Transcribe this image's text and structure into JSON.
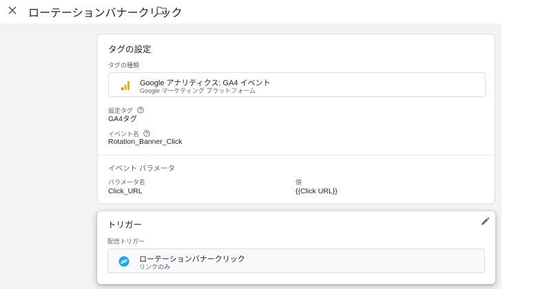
{
  "header": {
    "title": "ローテーションバナークリック",
    "close_icon": "close-icon",
    "folder_icon": "folder-icon"
  },
  "tag_config": {
    "section_title": "タグの設定",
    "tag_type_label": "タグの種類",
    "tag_type_name": "Google アナリティクス: GA4 イベント",
    "tag_type_sub": "Google マーケティング プラットフォーム",
    "config_tag_label": "設定タグ",
    "config_tag_value": "GA4タグ",
    "event_name_label": "イベント名",
    "event_name_value": "Rotation_Banner_Click",
    "event_params_title": "イベント パラメータ",
    "param_name_header": "パラメータ名",
    "param_value_header": "値",
    "params": [
      {
        "name": "Click_URL",
        "value": "{{Click URL}}"
      }
    ]
  },
  "trigger": {
    "section_title": "トリガー",
    "firing_label": "配信トリガー",
    "trigger_name": "ローテーションバナークリック",
    "trigger_sub": "リンクのみ",
    "edit_icon": "pencil-icon"
  },
  "colors": {
    "analytics_orange": "#f9ab00",
    "analytics_dark_orange": "#e37400",
    "link_blue": "#1da1f2",
    "grey_bg": "#f1f3f4"
  }
}
